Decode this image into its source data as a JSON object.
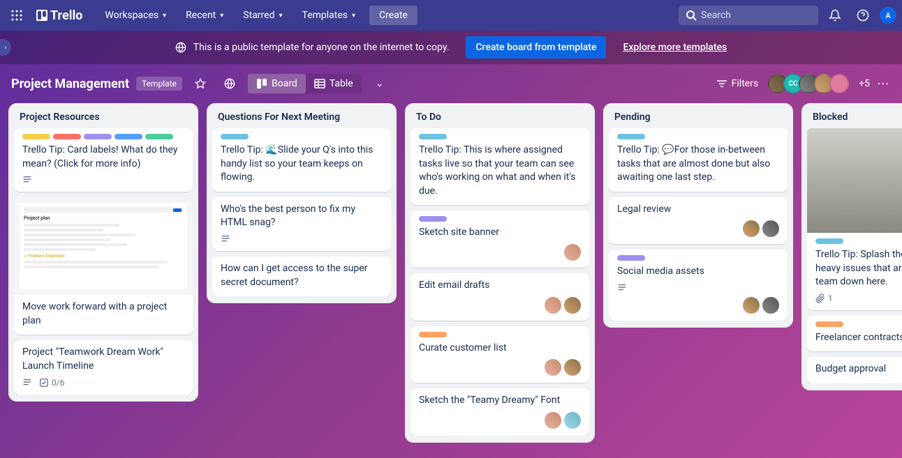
{
  "nav": {
    "logo": "Trello",
    "menu": [
      "Workspaces",
      "Recent",
      "Starred",
      "Templates"
    ],
    "create": "Create",
    "search_placeholder": "Search",
    "avatar_initial": "A"
  },
  "banner": {
    "text": "This is a public template for anyone on the internet to copy.",
    "primary": "Create board from template",
    "link": "Explore more templates"
  },
  "board_header": {
    "title": "Project Management",
    "badge": "Template",
    "views": {
      "board": "Board",
      "table": "Table"
    },
    "filters": "Filters",
    "member_initials": "CC",
    "more_members": "+5"
  },
  "lists": [
    {
      "title": "Project Resources",
      "cards": [
        {
          "labels": [
            "yellow",
            "red",
            "purple",
            "blue",
            "green"
          ],
          "title": "Trello Tip: Card labels! What do they mean? (Click for more info)",
          "badges": [
            "description"
          ]
        },
        {
          "cover": "doc",
          "title": "Move work forward with a project plan"
        },
        {
          "title": "Project \"Teamwork Dream Work\" Launch Timeline",
          "badges": [
            "description"
          ],
          "checklist": "0/6"
        }
      ]
    },
    {
      "title": "Questions For Next Meeting",
      "cards": [
        {
          "labels": [
            "sky"
          ],
          "title": "Trello Tip: 🌊Slide your Q's into this handy list so your team keeps on flowing."
        },
        {
          "title": "Who's the best person to fix my HTML snag?",
          "badges": [
            "description"
          ]
        },
        {
          "title": "How can I get access to the super secret document?"
        }
      ]
    },
    {
      "title": "To Do",
      "cards": [
        {
          "labels": [
            "sky"
          ],
          "title": "Trello Tip: This is where assigned tasks live so that your team can see who's working on what and when it's due."
        },
        {
          "labels": [
            "purple"
          ],
          "title": "Sketch site banner",
          "members": [
            "cm1"
          ]
        },
        {
          "title": "Edit email drafts",
          "members": [
            "cm1",
            "cm3"
          ]
        },
        {
          "labels": [
            "orange"
          ],
          "title": "Curate customer list",
          "members": [
            "cm1",
            "cm3"
          ]
        },
        {
          "title": "Sketch the \"Teamy Dreamy\" Font",
          "members": [
            "cm1",
            "cm2"
          ]
        }
      ]
    },
    {
      "title": "Pending",
      "cards": [
        {
          "labels": [
            "sky"
          ],
          "title": "Trello Tip: 💬For those in-between tasks that are almost done but also awaiting one last step."
        },
        {
          "title": "Legal review",
          "members": [
            "cm3",
            "cm4"
          ]
        },
        {
          "labels": [
            "purple"
          ],
          "title": "Social media assets",
          "badges": [
            "description"
          ],
          "members": [
            "cm3",
            "cm4"
          ]
        }
      ]
    },
    {
      "title": "Blocked",
      "cards": [
        {
          "cover": "photo",
          "labels": [
            "sky"
          ],
          "title": "Trello Tip: Splash those redtape-heavy issues that are slowing your team down here.",
          "attachments": "1"
        },
        {
          "labels": [
            "orange"
          ],
          "title": "Freelancer contracts"
        },
        {
          "title": "Budget approval"
        }
      ]
    }
  ]
}
